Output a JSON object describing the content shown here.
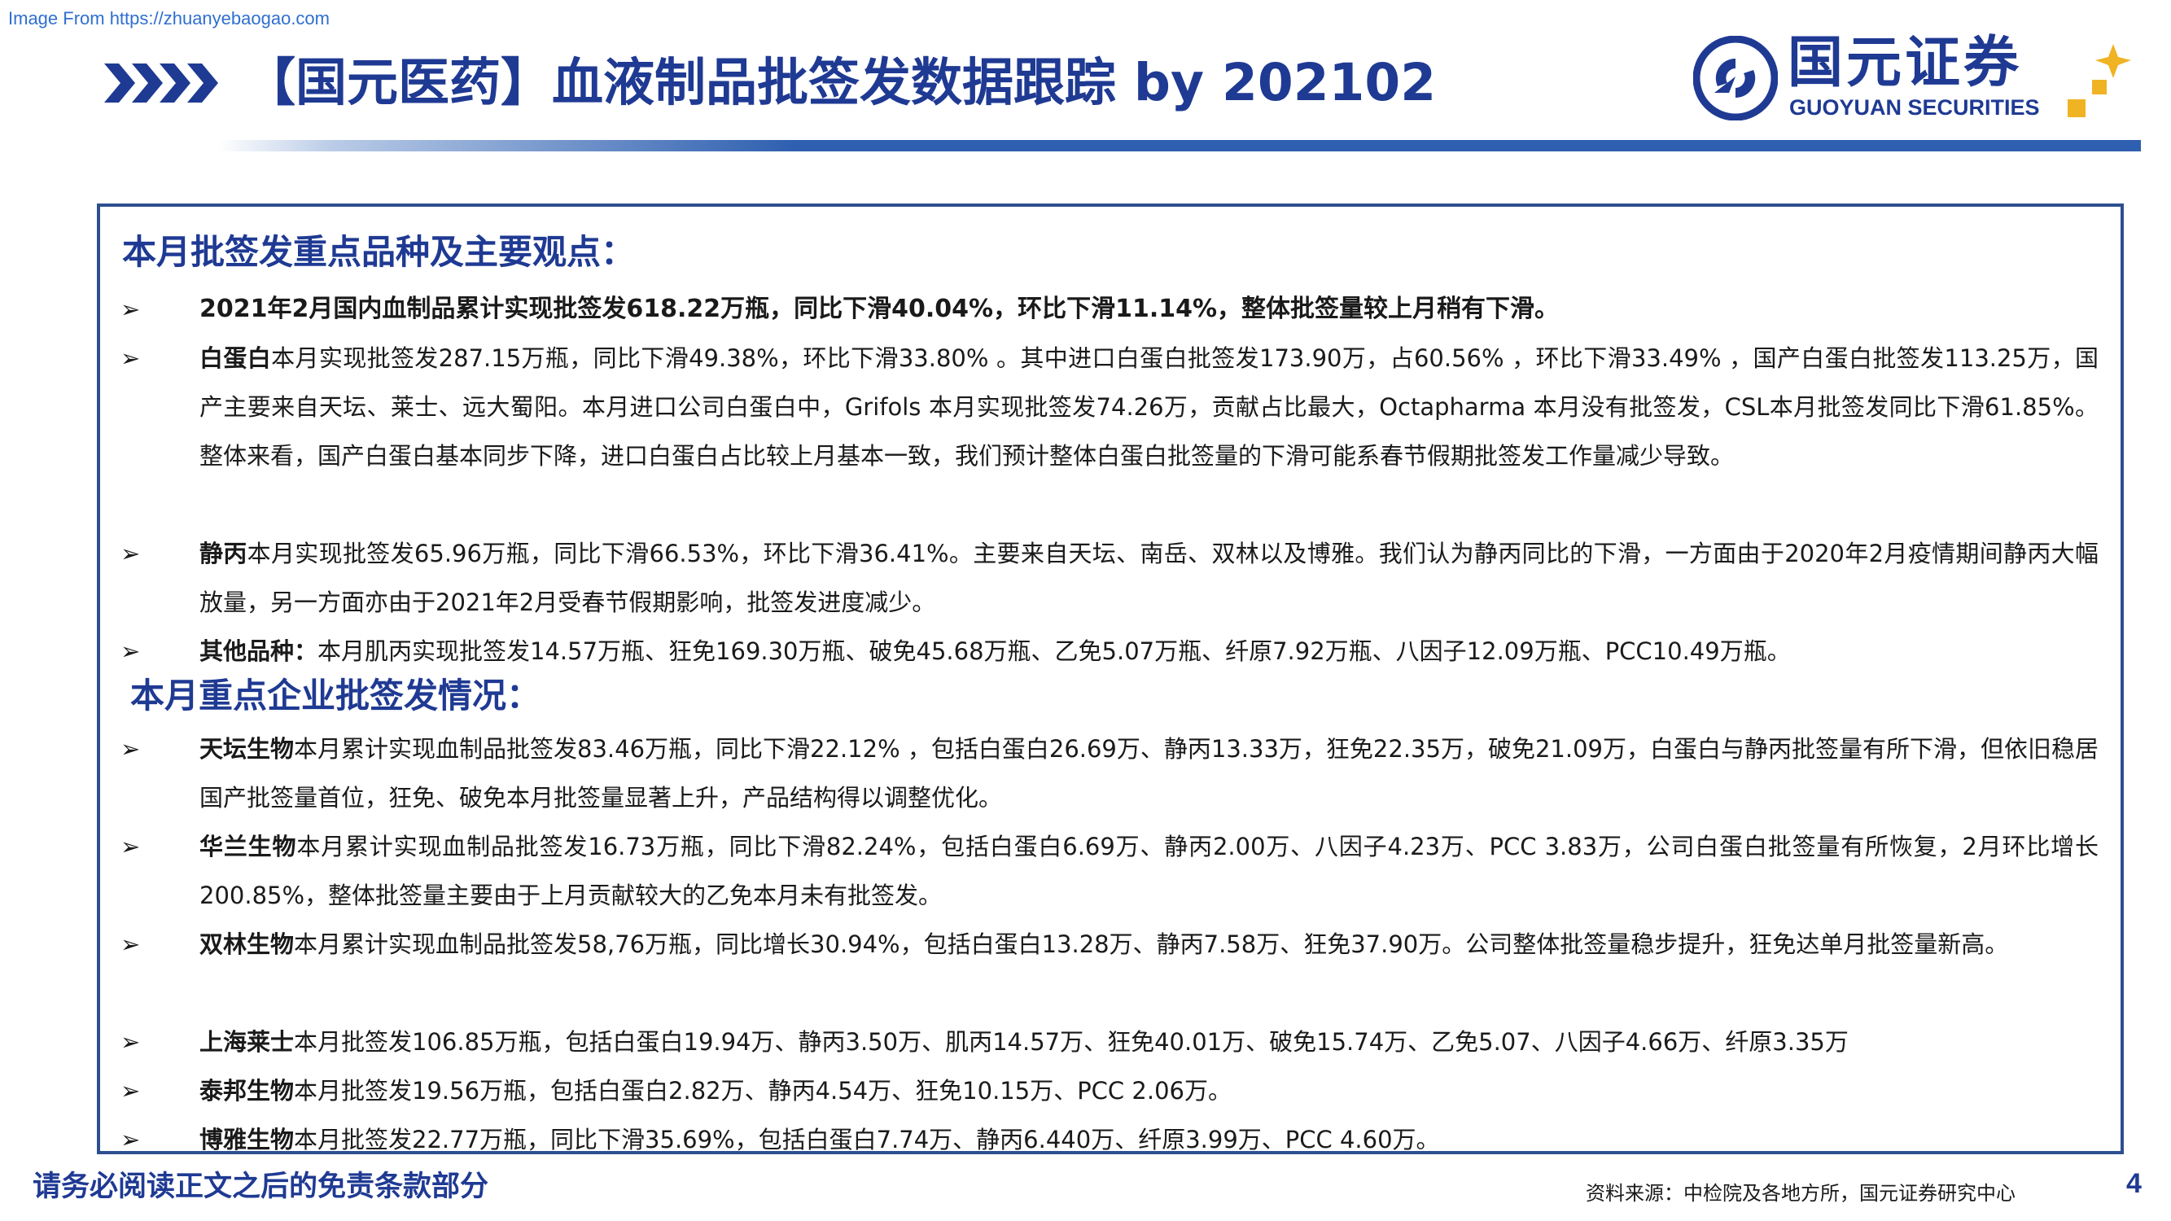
{
  "watermark": "Image From https://zhuanyebaogao.com",
  "header": {
    "title": "【国元医药】血液制品批签发数据跟踪 by 202102",
    "logo_cn": "国元证券",
    "logo_en": "GUOYUAN SECURITIES",
    "brand_color": "#1f3a93",
    "accent_color": "#f0b323"
  },
  "sections": [
    {
      "heading": "本月批签发重点品种及主要观点：",
      "items": [
        {
          "lead": "",
          "text": "2021年2月国内血制品累计实现批签发618.22万瓶，同比下滑40.04%，环比下滑11.14%，整体批签量较上月稍有下滑。"
        },
        {
          "lead": "白蛋白",
          "text": "本月实现批签发287.15万瓶，同比下滑49.38%，环比下滑33.80% 。其中进口白蛋白批签发173.90万，占60.56% ，环比下滑33.49% ，国产白蛋白批签发113.25万，国产主要来自天坛、莱士、远大蜀阳。本月进口公司白蛋白中，Grifols 本月实现批签发74.26万，贡献占比最大，Octapharma 本月没有批签发，CSL本月批签发同比下滑61.85%。整体来看，国产白蛋白基本同步下降，进口白蛋白占比较上月基本一致，我们预计整体白蛋白批签量的下滑可能系春节假期批签发工作量减少导致。"
        },
        {
          "lead": "静丙",
          "text": "本月实现批签发65.96万瓶，同比下滑66.53%，环比下滑36.41%。主要来自天坛、南岳、双林以及博雅。我们认为静丙同比的下滑，一方面由于2020年2月疫情期间静丙大幅放量，另一方面亦由于2021年2月受春节假期影响，批签发进度减少。"
        },
        {
          "lead": "其他品种：",
          "text": "本月肌丙实现批签发14.57万瓶、狂免169.30万瓶、破免45.68万瓶、乙免5.07万瓶、纤原7.92万瓶、八因子12.09万瓶、PCC10.49万瓶。"
        }
      ]
    },
    {
      "heading": "本月重点企业批签发情况：",
      "items": [
        {
          "lead": "天坛生物",
          "text": "本月累计实现血制品批签发83.46万瓶，同比下滑22.12% ，包括白蛋白26.69万、静丙13.33万，狂免22.35万，破免21.09万，白蛋白与静丙批签量有所下滑，但依旧稳居国产批签量首位，狂免、破免本月批签量显著上升，产品结构得以调整优化。"
        },
        {
          "lead": "华兰生物",
          "text": "本月累计实现血制品批签发16.73万瓶，同比下滑82.24%，包括白蛋白6.69万、静丙2.00万、八因子4.23万、PCC 3.83万，公司白蛋白批签量有所恢复，2月环比增长200.85%，整体批签量主要由于上月贡献较大的乙免本月未有批签发。"
        },
        {
          "lead": "双林生物",
          "text": "本月累计实现血制品批签发58,76万瓶，同比增长30.94%，包括白蛋白13.28万、静丙7.58万、狂免37.90万。公司整体批签量稳步提升，狂免达单月批签量新高。"
        },
        {
          "lead": "上海莱士",
          "text": "本月批签发106.85万瓶，包括白蛋白19.94万、静丙3.50万、肌丙14.57万、狂免40.01万、破免15.74万、乙免5.07、八因子4.66万、纤原3.35万"
        },
        {
          "lead": "泰邦生物",
          "text": "本月批签发19.56万瓶，包括白蛋白2.82万、静丙4.54万、狂免10.15万、PCC 2.06万。"
        },
        {
          "lead": "博雅生物",
          "text": "本月批签发22.77万瓶，同比下滑35.69%，包括白蛋白7.74万、静丙6.440万、纤原3.99万、PCC 4.60万。"
        }
      ]
    }
  ],
  "bullet_symbol": "➢",
  "footer": {
    "disclaimer": "请务必阅读正文之后的免责条款部分",
    "source": "资料来源：中检院及各地方所，国元证券研究中心",
    "page_number": "4"
  }
}
